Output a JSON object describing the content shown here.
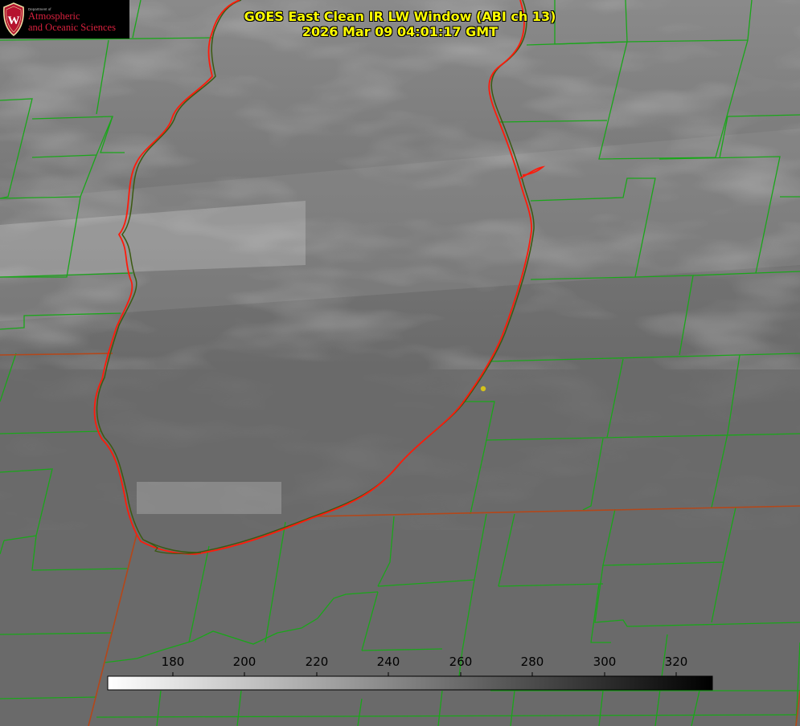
{
  "title": {
    "line1": "GOES East Clean IR LW Window (ABI ch 13)",
    "line2": "2026 Mar 09 04:01:17 GMT"
  },
  "logo": {
    "department": "Department of",
    "line1": "Atmospheric",
    "line2": "and Oceanic Sciences",
    "seal_letter": "W",
    "color": "#d8213e"
  },
  "colorbar": {
    "ticks": [
      "180",
      "200",
      "220",
      "240",
      "260",
      "280",
      "300",
      "320"
    ],
    "gradient": "white-to-black"
  },
  "map_colors": {
    "lake_shore": "#ff2a1a",
    "county_lines": "#1aa61a",
    "state_lines": "#b3471a",
    "marker": "#d4c21a"
  },
  "icons": {
    "logo": "university-seal-icon",
    "marker": "location-dot-icon"
  }
}
